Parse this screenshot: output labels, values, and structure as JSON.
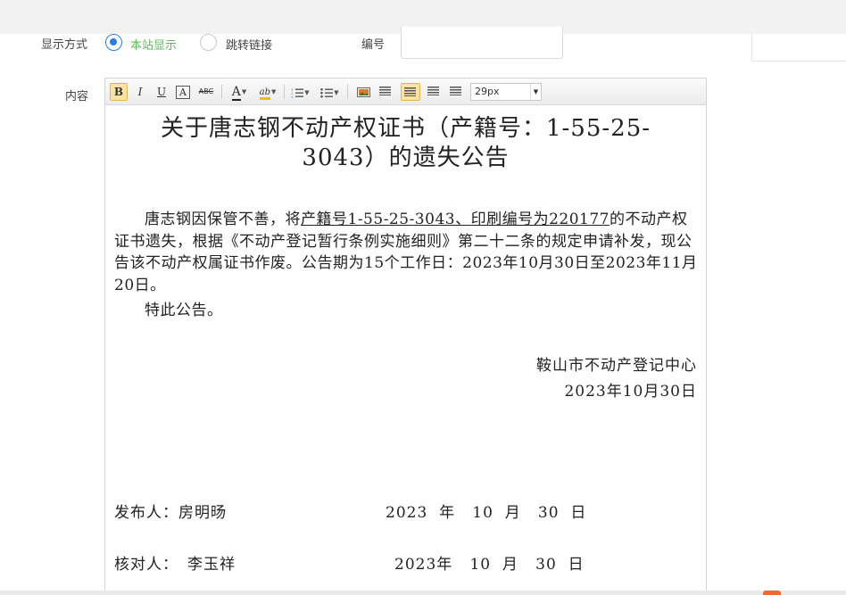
{
  "form": {
    "display_label": "显示方式",
    "option_local": "本站显示",
    "option_redirect": "跳转链接",
    "number_label": "编号",
    "content_label": "内容"
  },
  "toolbar": {
    "bold": "B",
    "italic": "I",
    "underline": "U",
    "border": "A",
    "strike": "ABC",
    "font_color": "A",
    "highlight": "ab",
    "font_size_value": "29px"
  },
  "document": {
    "title_line1": "关于唐志钢不动产权证书（产籍号：1-55-25-",
    "title_line2": "3043）的遗失公告",
    "body_intro": "唐志钢因保管不善，将",
    "body_underlined": "产籍号1-55-25-3043、印刷编号为220177",
    "body_rest": "的不动产权证书遗失，根据《不动产登记暂行条例实施细则》第二十二条的规定申请补发，现公告该不动产权属证书作废。公告期为15个工作日：2023年10月30日至2023年11月20日。",
    "body_closing": "特此公告。",
    "signer": "鞍山市不动产登记中心",
    "sign_date": "2023年10月30日",
    "publisher_label": "发布人：",
    "publisher_name": "房明旸",
    "publisher_date": "2023  年   10  月   30  日",
    "reviewer_label": "核对人：",
    "reviewer_name": "李玉祥",
    "reviewer_date": "2023年   10  月   30  日"
  },
  "colors": {
    "radio_selected": "#2f7de1",
    "selected_label": "#5cb85c",
    "active_button": "#fbe3a6",
    "accent_mark": "#f06a35"
  }
}
